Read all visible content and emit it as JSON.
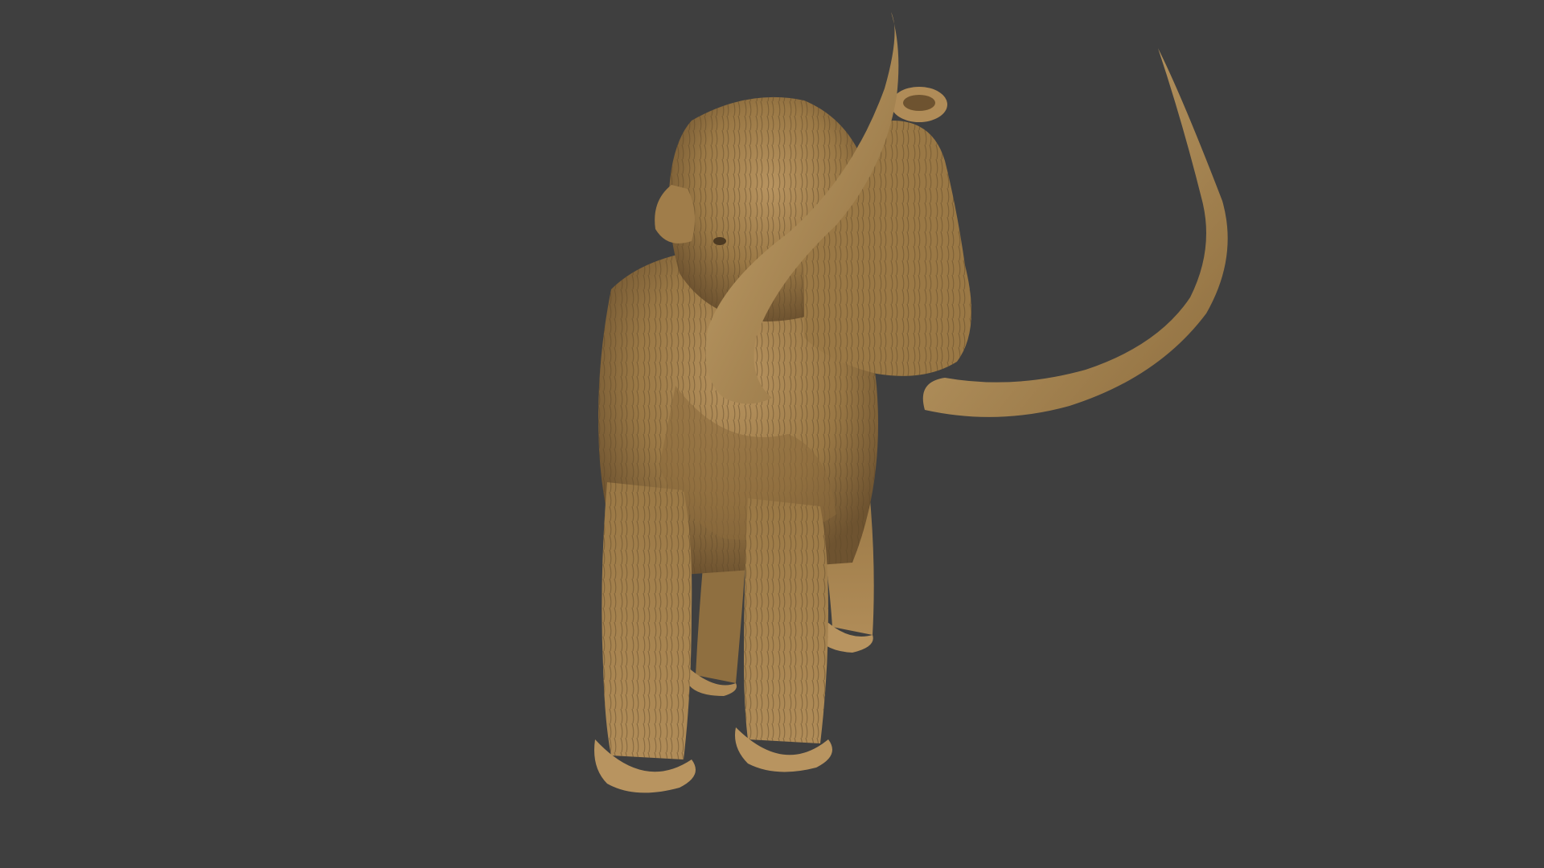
{
  "scene": {
    "background_color": "#3f3f3f",
    "subject": "mammoth-sculpt",
    "colors": {
      "clay_light": "#b89460",
      "clay_mid": "#9a7845",
      "clay_dark": "#6e5330",
      "clay_shadow": "#4d3a22",
      "tusk": "#a8864f",
      "tusk_highlight": "#c7a56e"
    }
  }
}
